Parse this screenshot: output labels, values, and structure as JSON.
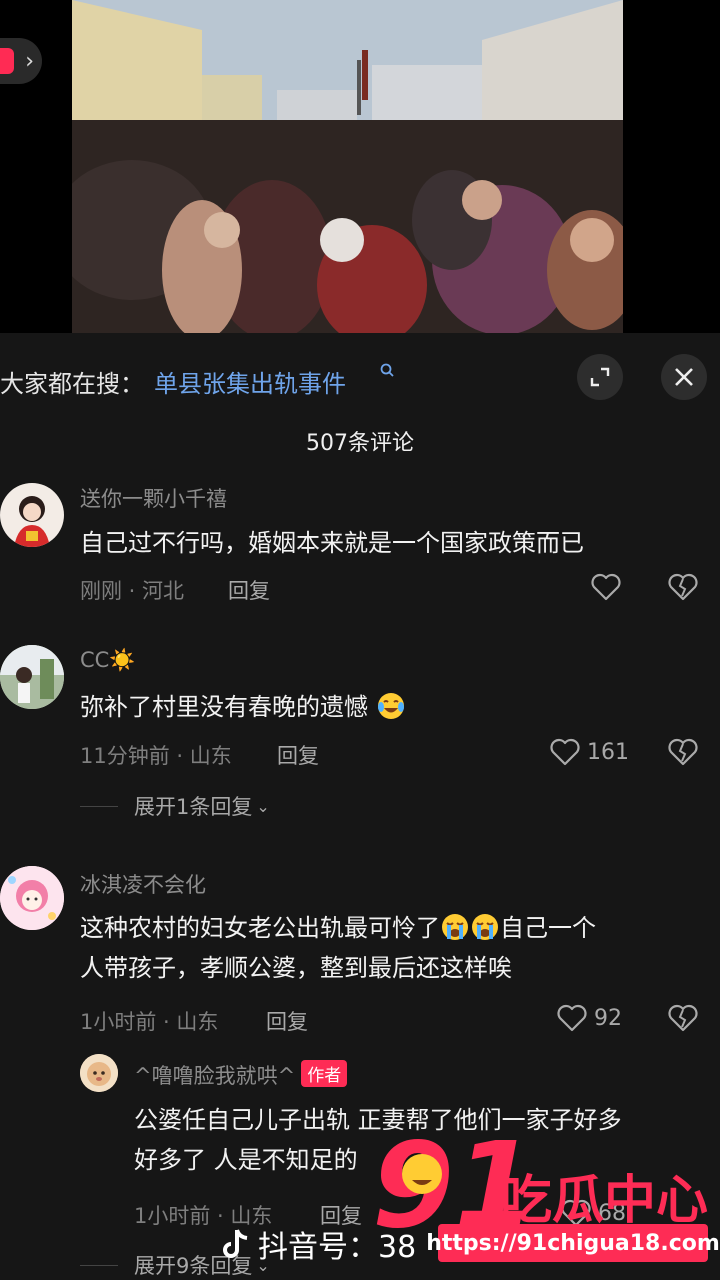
{
  "search": {
    "prefix": "大家都在搜：",
    "term": "单县张集出轨事件",
    "icon": "search-icon"
  },
  "comments_header": {
    "count_label": "507条评论"
  },
  "comments": [
    {
      "username": "送你一颗小千禧",
      "text": "自己过不行吗，婚姻本来就是一个国家政策而已",
      "meta": "刚刚 · 河北",
      "reply": "回复",
      "likes": ""
    },
    {
      "username": "CC☀️",
      "text": "弥补了村里没有春晚的遗憾",
      "meta": "11分钟前 · 山东",
      "reply": "回复",
      "likes": "161",
      "expand": "展开1条回复"
    },
    {
      "username": "冰淇凌不会化",
      "text_line1": "这种农村的妇女老公出轨最可怜了",
      "text_line1_tail": "自己一个",
      "text_line2": "人带孩子，孝顺公婆，整到最后还这样唉",
      "meta": "1小时前 · 山东",
      "reply": "回复",
      "likes": "92"
    },
    {
      "username": "^噜噜脸我就哄^",
      "badge": "作者",
      "text_line1": "公婆任自己儿子出轨 正妻帮了他们一家子好多",
      "text_line2": "好多了 人是不知足的",
      "meta": "1小时前 · 山东",
      "reply": "回复",
      "likes": "68",
      "expand": "展开9条回复"
    }
  ],
  "watermark": {
    "douyin_label": "抖音号：38",
    "brand_number": "91",
    "brand_text": "吃瓜中心",
    "url": "https://91chigua18.com"
  },
  "colors": {
    "background": "#161616",
    "link_blue": "#6fa4ea",
    "accent_red": "#fe2c55"
  }
}
